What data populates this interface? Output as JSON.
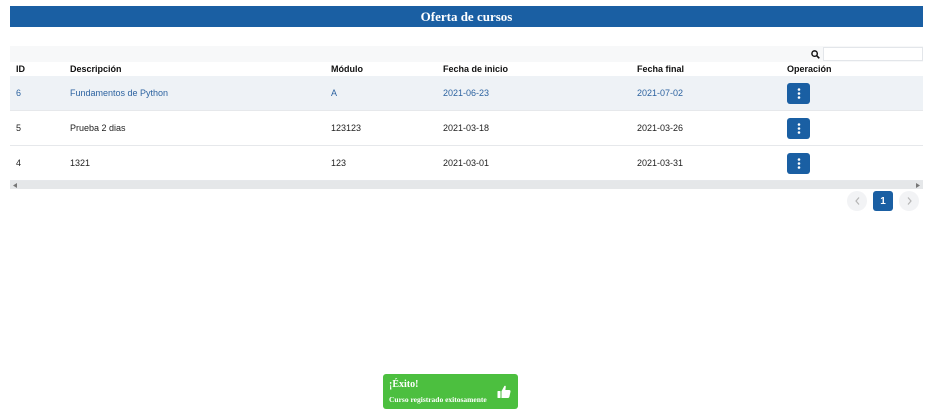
{
  "header": {
    "title": "Oferta de cursos"
  },
  "search": {
    "placeholder": ""
  },
  "table": {
    "columns": [
      "ID",
      "Descripción",
      "Módulo",
      "Fecha de inicio",
      "Fecha final",
      "Operación"
    ],
    "rows": [
      {
        "id": "6",
        "descripcion": "Fundamentos de Python",
        "modulo": "A",
        "inicio": "2021-06-23",
        "final": "2021-07-02"
      },
      {
        "id": "5",
        "descripcion": "Prueba 2 dias",
        "modulo": "123123",
        "inicio": "2021-03-18",
        "final": "2021-03-26"
      },
      {
        "id": "4",
        "descripcion": "1321",
        "modulo": "123",
        "inicio": "2021-03-01",
        "final": "2021-03-31"
      }
    ]
  },
  "pagination": {
    "current": "1",
    "prev_icon": "chevron-left-icon",
    "next_icon": "chevron-right-icon"
  },
  "toast": {
    "title": "¡Éxito!",
    "message": "Curso registrado exitosamente",
    "icon": "thumbs-up-icon"
  },
  "colors": {
    "primary": "#1a5fa3",
    "success": "#4cbf3f",
    "selected_row": "#eef2f6",
    "selected_text": "#2d63a0"
  }
}
